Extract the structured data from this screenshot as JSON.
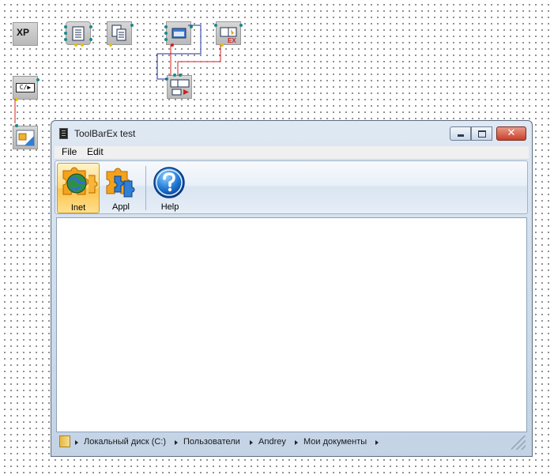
{
  "canvas": {
    "nodes": [
      {
        "name": "xp-theme",
        "label": "XP"
      },
      {
        "name": "form-module"
      },
      {
        "name": "list-module"
      },
      {
        "name": "window-module"
      },
      {
        "name": "toolbarex-module"
      },
      {
        "name": "toolbar-link-module"
      },
      {
        "name": "code-module",
        "label": "C/▶"
      },
      {
        "name": "image-module"
      }
    ]
  },
  "window": {
    "title": "ToolBarEx test",
    "close_glyph": "✕"
  },
  "menu": {
    "file": "File",
    "edit": "Edit"
  },
  "toolbar": {
    "buttons": [
      {
        "label": "Inet",
        "icon": "globe-puzzle-icon",
        "active": true
      },
      {
        "label": "Appl",
        "icon": "puzzle-icon",
        "active": false
      },
      {
        "label": "Help",
        "icon": "help-icon",
        "active": false
      }
    ]
  },
  "statusbar": {
    "path": [
      "Локальный диск (C:)",
      "Пользователи",
      "Andrey",
      "Мои документы"
    ]
  },
  "colors": {
    "accent": "#ffd77a",
    "wire_red": "#d02020",
    "wire_blue": "#1f2fa0"
  }
}
